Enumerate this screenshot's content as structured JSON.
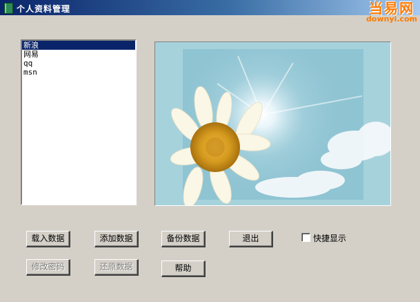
{
  "window": {
    "title": "个人资料管理"
  },
  "watermark": {
    "cn": "当易网",
    "en": "downyi.com"
  },
  "listbox": {
    "items": [
      "新浪",
      "网易",
      "qq",
      "msn"
    ],
    "selected_index": 0
  },
  "picture": {
    "description_icon": "daisy-sky-photo"
  },
  "buttons": {
    "load": "载入数据",
    "add": "添加数据",
    "backup": "备份数据",
    "exit": "退出",
    "change_password": "修改密码",
    "restore": "还原数据",
    "help": "帮助"
  },
  "quick_show": {
    "label": "快捷显示",
    "checked": false
  },
  "colors": {
    "titlebar_start": "#0a246a",
    "face": "#d4d0c8",
    "selection": "#0a246a",
    "watermark": "#ff7a00"
  }
}
